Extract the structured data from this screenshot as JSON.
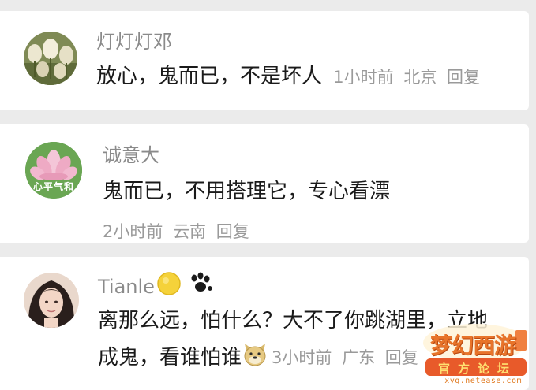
{
  "comments": [
    {
      "username": "灯灯灯邓",
      "text": "放心，鬼而已，不是坏人",
      "time": "1小时前",
      "location": "北京",
      "reply_label": "回复"
    },
    {
      "username": "诚意大",
      "text": "鬼而已，不用搭理它，专心看漂",
      "time": "2小时前",
      "location": "云南",
      "reply_label": "回复",
      "avatar_caption": "心平气和"
    },
    {
      "username": "Tianle",
      "text_line1": "离那么远，怕什么？大不了你跳湖里，立地",
      "text_line2": "成鬼，看谁怕谁",
      "time": "3小时前",
      "location": "广东",
      "reply_label": "回复"
    }
  ],
  "watermark": {
    "brand": "梦幻西游",
    "sub": "官方论坛",
    "url": "xyq.netease.com"
  },
  "icons": {
    "sun_emoji": "sun-icon",
    "paw_emoji": "paw-icon",
    "doge_emoji": "doge-icon"
  }
}
